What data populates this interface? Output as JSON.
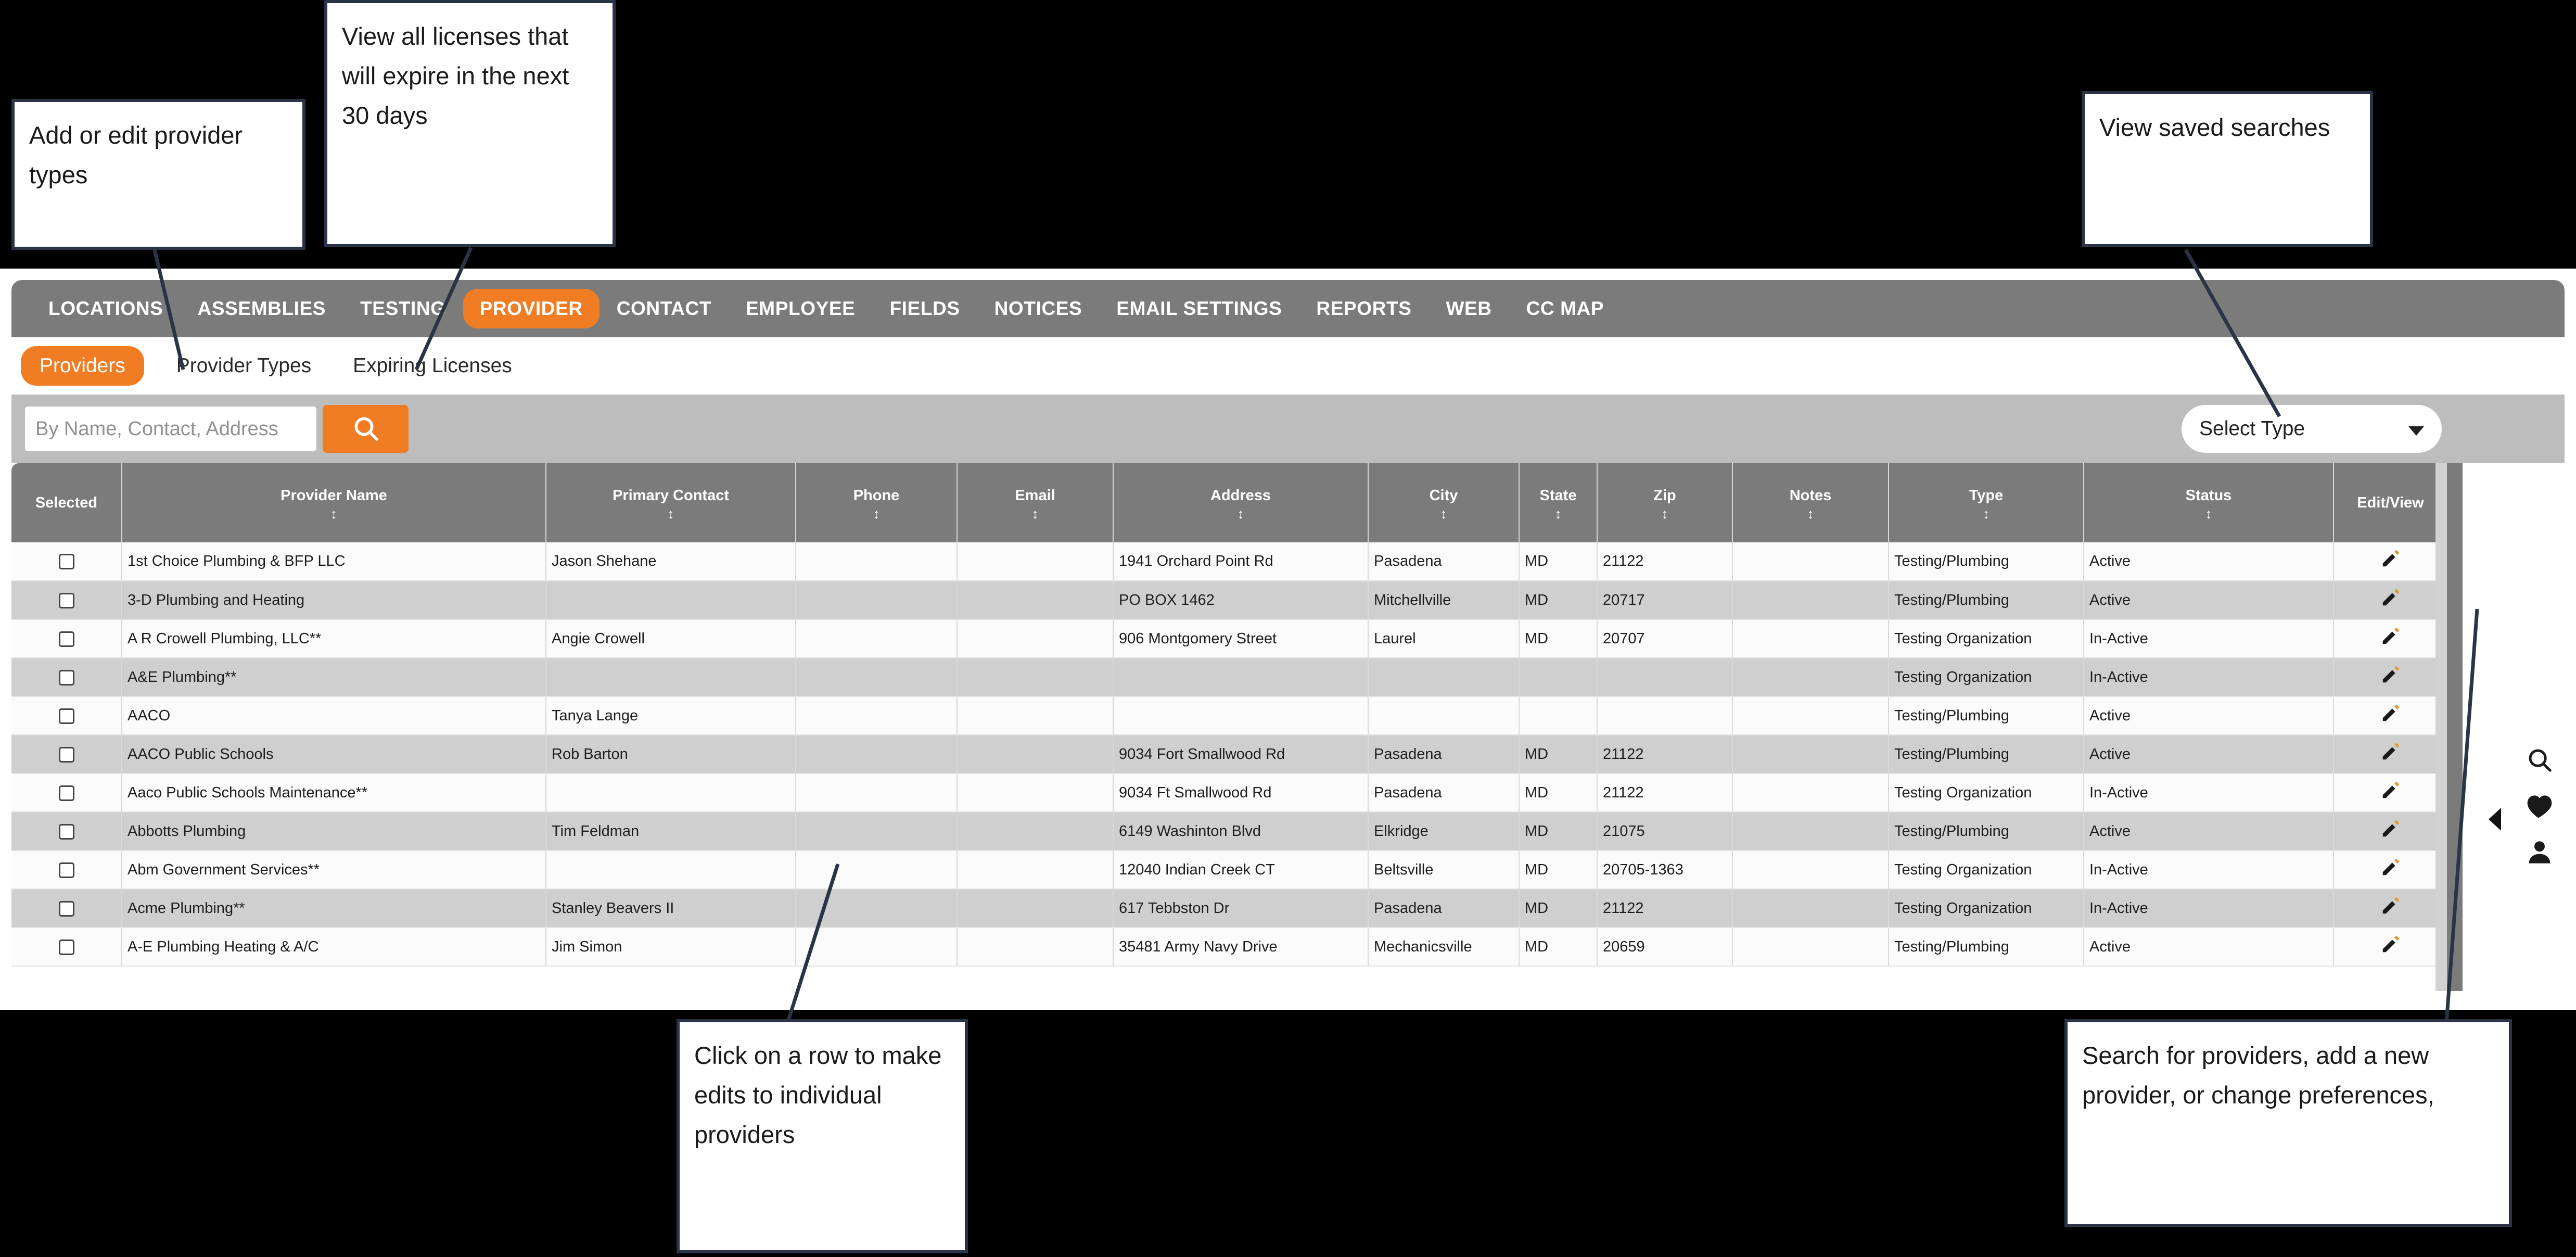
{
  "app": {
    "accent_color": "#f07d23",
    "nav_bg": "#7b7b7b"
  },
  "topnav": {
    "items": [
      {
        "label": "LOCATIONS",
        "active": false
      },
      {
        "label": "ASSEMBLIES",
        "active": false
      },
      {
        "label": "TESTING",
        "active": false
      },
      {
        "label": "PROVIDER",
        "active": true
      },
      {
        "label": "CONTACT",
        "active": false
      },
      {
        "label": "EMPLOYEE",
        "active": false
      },
      {
        "label": "FIELDS",
        "active": false
      },
      {
        "label": "NOTICES",
        "active": false
      },
      {
        "label": "EMAIL SETTINGS",
        "active": false
      },
      {
        "label": "REPORTS",
        "active": false
      },
      {
        "label": "WEB",
        "active": false
      },
      {
        "label": "CC MAP",
        "active": false
      }
    ]
  },
  "subnav": {
    "items": [
      {
        "label": "Providers",
        "active": true
      },
      {
        "label": "Provider Types",
        "active": false
      },
      {
        "label": "Expiring Licenses",
        "active": false
      }
    ]
  },
  "search": {
    "placeholder": "By Name, Contact, Address",
    "value": "",
    "button_icon": "search-icon",
    "select_type_label": "Select Type"
  },
  "rail": {
    "icons": [
      "search-icon",
      "heart-icon",
      "person-icon"
    ],
    "toggle_icon": "chevron-left-icon"
  },
  "table": {
    "columns": [
      {
        "label": "Selected",
        "sortable": false
      },
      {
        "label": "Provider Name",
        "sortable": true
      },
      {
        "label": "Primary Contact",
        "sortable": true
      },
      {
        "label": "Phone",
        "sortable": true
      },
      {
        "label": "Email",
        "sortable": true
      },
      {
        "label": "Address",
        "sortable": true
      },
      {
        "label": "City",
        "sortable": true
      },
      {
        "label": "State",
        "sortable": true
      },
      {
        "label": "Zip",
        "sortable": true
      },
      {
        "label": "Notes",
        "sortable": true
      },
      {
        "label": "Type",
        "sortable": true
      },
      {
        "label": "Status",
        "sortable": true
      },
      {
        "label": "Edit/View",
        "sortable": false
      }
    ],
    "sort_glyph": "↕",
    "edit_icon": "pencil-icon",
    "rows": [
      {
        "selected": false,
        "provider_name": "1st Choice Plumbing & BFP LLC",
        "primary_contact": "Jason Shehane",
        "phone": "",
        "email": "",
        "address": "1941 Orchard Point Rd",
        "city": "Pasadena",
        "state": "MD",
        "zip": "21122",
        "notes": "",
        "type": "Testing/Plumbing",
        "status": "Active"
      },
      {
        "selected": false,
        "provider_name": "3-D Plumbing and Heating",
        "primary_contact": "",
        "phone": "",
        "email": "",
        "address": "PO BOX 1462",
        "city": "Mitchellville",
        "state": "MD",
        "zip": "20717",
        "notes": "",
        "type": "Testing/Plumbing",
        "status": "Active"
      },
      {
        "selected": false,
        "provider_name": "A R Crowell Plumbing, LLC**",
        "primary_contact": "Angie Crowell",
        "phone": "",
        "email": "",
        "address": "906 Montgomery Street",
        "city": "Laurel",
        "state": "MD",
        "zip": "20707",
        "notes": "",
        "type": "Testing Organization",
        "status": "In-Active"
      },
      {
        "selected": false,
        "provider_name": "A&E Plumbing**",
        "primary_contact": "",
        "phone": "",
        "email": "",
        "address": "",
        "city": "",
        "state": "",
        "zip": "",
        "notes": "",
        "type": "Testing Organization",
        "status": "In-Active"
      },
      {
        "selected": false,
        "provider_name": "AACO",
        "primary_contact": "Tanya Lange",
        "phone": "",
        "email": "",
        "address": "",
        "city": "",
        "state": "",
        "zip": "",
        "notes": "",
        "type": "Testing/Plumbing",
        "status": "Active"
      },
      {
        "selected": false,
        "provider_name": "AACO Public Schools",
        "primary_contact": "Rob Barton",
        "phone": "",
        "email": "",
        "address": "9034 Fort Smallwood Rd",
        "city": "Pasadena",
        "state": "MD",
        "zip": "21122",
        "notes": "",
        "type": "Testing/Plumbing",
        "status": "Active"
      },
      {
        "selected": false,
        "provider_name": "Aaco Public Schools Maintenance**",
        "primary_contact": "",
        "phone": "",
        "email": "",
        "address": "9034 Ft Smallwood Rd",
        "city": "Pasadena",
        "state": "MD",
        "zip": "21122",
        "notes": "",
        "type": "Testing Organization",
        "status": "In-Active"
      },
      {
        "selected": false,
        "provider_name": "Abbotts Plumbing",
        "primary_contact": "Tim Feldman",
        "phone": "",
        "email": "",
        "address": "6149 Washinton Blvd",
        "city": "Elkridge",
        "state": "MD",
        "zip": "21075",
        "notes": "",
        "type": "Testing/Plumbing",
        "status": "Active"
      },
      {
        "selected": false,
        "provider_name": "Abm Government Services**",
        "primary_contact": "",
        "phone": "",
        "email": "",
        "address": "12040 Indian Creek CT",
        "city": "Beltsville",
        "state": "MD",
        "zip": "20705-1363",
        "notes": "",
        "type": "Testing Organization",
        "status": "In-Active"
      },
      {
        "selected": false,
        "provider_name": "Acme Plumbing**",
        "primary_contact": "Stanley Beavers II",
        "phone": "",
        "email": "",
        "address": "617 Tebbston Dr",
        "city": "Pasadena",
        "state": "MD",
        "zip": "21122",
        "notes": "",
        "type": "Testing Organization",
        "status": "In-Active"
      },
      {
        "selected": false,
        "provider_name": "A-E Plumbing Heating & A/C",
        "primary_contact": "Jim Simon",
        "phone": "",
        "email": "",
        "address": "35481 Army Navy Drive",
        "city": "Mechanicsville",
        "state": "MD",
        "zip": "20659",
        "notes": "",
        "type": "Testing/Plumbing",
        "status": "Active"
      }
    ]
  },
  "annotations": [
    {
      "id": "provider-types",
      "text": "Add or edit provider types"
    },
    {
      "id": "expiring-licenses",
      "text": "View all licenses that will expire in the next 30 days"
    },
    {
      "id": "saved-searches",
      "text": "View saved searches"
    },
    {
      "id": "row-edit",
      "text": "Click on a row to make edits to individual providers"
    },
    {
      "id": "right-rail",
      "text": "Search for providers, add a new provider, or change preferences,"
    }
  ]
}
